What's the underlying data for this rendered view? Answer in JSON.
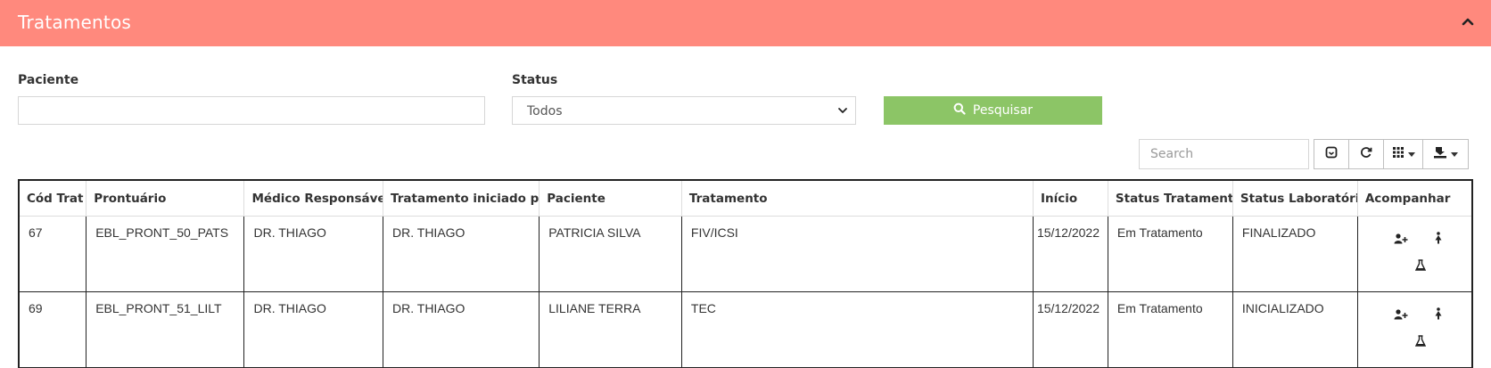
{
  "panel": {
    "title": "Tratamentos",
    "collapse_icon": "chevron-up-icon"
  },
  "filters": {
    "patient_label": "Paciente",
    "patient_value": "",
    "status_label": "Status",
    "status_selected": "Todos",
    "search_button_label": "Pesquisar",
    "search_button_icon": "search-icon"
  },
  "toolbar": {
    "search_placeholder": "Search",
    "buttons": [
      "toggle-icon",
      "refresh-icon",
      "columns-icon",
      "export-icon"
    ]
  },
  "table": {
    "columns": [
      "Cód Trat",
      "Prontuário",
      "Médico Responsável",
      "Tratamento iniciado por",
      "Paciente",
      "Tratamento",
      "Início",
      "Status Tratamento",
      "Status Laboratório",
      "Acompanhar"
    ],
    "rows": [
      {
        "cod": "67",
        "prontuario": "EBL_PRONT_50_PATS",
        "medico": "DR. THIAGO",
        "iniciado_por": "DR. THIAGO",
        "paciente": "PATRICIA SILVA",
        "tratamento": "FIV/ICSI",
        "inicio": "15/12/2022",
        "status_tratamento": "Em Tratamento",
        "status_laboratorio": "FINALIZADO"
      },
      {
        "cod": "69",
        "prontuario": "EBL_PRONT_51_LILT",
        "medico": "DR. THIAGO",
        "iniciado_por": "DR. THIAGO",
        "paciente": "LILIANE TERRA",
        "tratamento": "TEC",
        "inicio": "15/12/2022",
        "status_tratamento": "Em Tratamento",
        "status_laboratorio": "INICIALIZADO"
      }
    ],
    "action_icons": [
      "add-user-icon",
      "female-icon",
      "flask-icon"
    ]
  },
  "colors": {
    "header_bg": "#ff897d",
    "search_button_bg": "#8cc566",
    "table_border": "#222222"
  }
}
